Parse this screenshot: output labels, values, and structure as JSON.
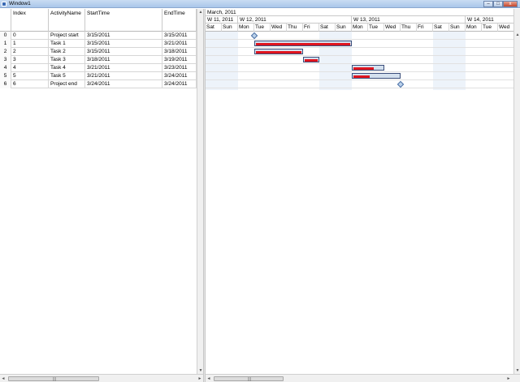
{
  "window": {
    "title": "Window1",
    "faded_title": "",
    "minimize_glyph": "–",
    "maximize_glyph": "□",
    "close_glyph": "x"
  },
  "grid": {
    "columns": [
      "",
      "Index",
      "ActivityName",
      "StartTime",
      "EndTime"
    ],
    "rows": [
      {
        "row_header": "0",
        "index": "0",
        "name": "Project start",
        "start": "3/15/2011",
        "end": "3/15/2011"
      },
      {
        "row_header": "1",
        "index": "1",
        "name": "Task 1",
        "start": "3/15/2011",
        "end": "3/21/2011"
      },
      {
        "row_header": "2",
        "index": "2",
        "name": "Task 2",
        "start": "3/15/2011",
        "end": "3/18/2011"
      },
      {
        "row_header": "3",
        "index": "3",
        "name": "Task 3",
        "start": "3/18/2011",
        "end": "3/19/2011"
      },
      {
        "row_header": "4",
        "index": "4",
        "name": "Task 4",
        "start": "3/21/2011",
        "end": "3/23/2011"
      },
      {
        "row_header": "5",
        "index": "5",
        "name": "Task 5",
        "start": "3/21/2011",
        "end": "3/24/2011"
      },
      {
        "row_header": "6",
        "index": "6",
        "name": "Project end",
        "start": "3/24/2011",
        "end": "3/24/2011"
      }
    ]
  },
  "gantt": {
    "month_label": "March, 2011",
    "weeks": [
      "W 11, 2011",
      "W 12, 2011",
      "W 13, 2011",
      "W 14, 2011"
    ],
    "days": [
      "Sat",
      "Sun",
      "Mon",
      "Tue",
      "Wed",
      "Thu",
      "Fri",
      "Sat",
      "Sun",
      "Mon",
      "Tue",
      "Wed",
      "Thu",
      "Fri",
      "Sat",
      "Sun",
      "Mon",
      "Tue",
      "Wed"
    ],
    "weekend_color": "#edf3fa",
    "bar_fill": "#d4e0ee",
    "bar_border": "#3b4e7a",
    "progress_color": "#e0141e",
    "tasks": [
      {
        "type": "milestone",
        "date": "3/15/2011"
      },
      {
        "type": "bar",
        "start": "3/15/2011",
        "end": "3/21/2011",
        "progress": 1.0
      },
      {
        "type": "bar",
        "start": "3/15/2011",
        "end": "3/18/2011",
        "progress": 1.0
      },
      {
        "type": "bar",
        "start": "3/18/2011",
        "end": "3/19/2011",
        "progress": 1.0
      },
      {
        "type": "bar",
        "start": "3/21/2011",
        "end": "3/23/2011",
        "progress": 0.7
      },
      {
        "type": "bar",
        "start": "3/21/2011",
        "end": "3/24/2011",
        "progress": 0.35
      },
      {
        "type": "milestone",
        "date": "3/24/2011"
      }
    ]
  },
  "scroll": {
    "up_glyph": "▲",
    "down_glyph": "▼",
    "left_glyph": "◄",
    "right_glyph": "►",
    "grip_glyph": "|||"
  }
}
